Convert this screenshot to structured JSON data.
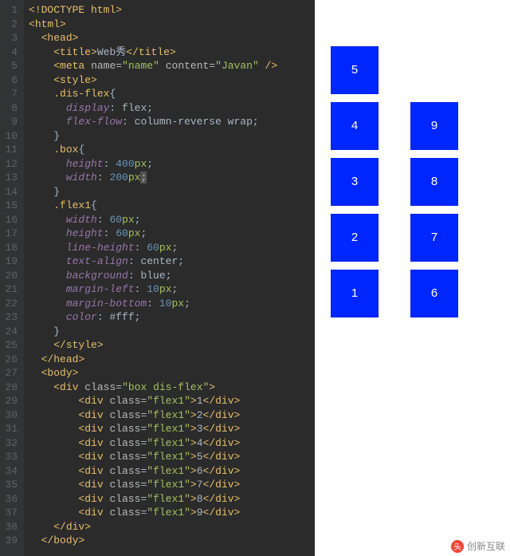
{
  "editor": {
    "line_count": 39,
    "active_line": 13,
    "lines": [
      {
        "n": 1,
        "indent": 0,
        "type": "doctype",
        "text": "<!DOCTYPE html>"
      },
      {
        "n": 2,
        "indent": 0,
        "type": "open",
        "tag": "html"
      },
      {
        "n": 3,
        "indent": 1,
        "type": "open",
        "tag": "head"
      },
      {
        "n": 4,
        "indent": 2,
        "type": "wrap",
        "tag": "title",
        "inner": "Web秀"
      },
      {
        "n": 5,
        "indent": 2,
        "type": "meta",
        "tag": "meta",
        "attrs": [
          [
            "name",
            "name"
          ],
          [
            "content",
            "Javan"
          ]
        ],
        "self_close": true
      },
      {
        "n": 6,
        "indent": 2,
        "type": "open",
        "tag": "style"
      },
      {
        "n": 7,
        "indent": 2,
        "type": "sel_open",
        "sel": ".dis-flex"
      },
      {
        "n": 8,
        "indent": 3,
        "type": "decl",
        "prop": "display",
        "val": "flex"
      },
      {
        "n": 9,
        "indent": 3,
        "type": "decl",
        "prop": "flex-flow",
        "val": "column-reverse wrap"
      },
      {
        "n": 10,
        "indent": 2,
        "type": "sel_close"
      },
      {
        "n": 11,
        "indent": 2,
        "type": "sel_open",
        "sel": ".box"
      },
      {
        "n": 12,
        "indent": 3,
        "type": "decl",
        "prop": "height",
        "num": "400",
        "unit": "px"
      },
      {
        "n": 13,
        "indent": 3,
        "type": "decl",
        "prop": "width",
        "num": "200",
        "unit": "px",
        "cursor": true
      },
      {
        "n": 14,
        "indent": 2,
        "type": "sel_close"
      },
      {
        "n": 15,
        "indent": 2,
        "type": "sel_open",
        "sel": ".flex1"
      },
      {
        "n": 16,
        "indent": 3,
        "type": "decl",
        "prop": "width",
        "num": "60",
        "unit": "px"
      },
      {
        "n": 17,
        "indent": 3,
        "type": "decl",
        "prop": "height",
        "num": "60",
        "unit": "px"
      },
      {
        "n": 18,
        "indent": 3,
        "type": "decl",
        "prop": "line-height",
        "num": "60",
        "unit": "px"
      },
      {
        "n": 19,
        "indent": 3,
        "type": "decl",
        "prop": "text-align",
        "val": "center"
      },
      {
        "n": 20,
        "indent": 3,
        "type": "decl",
        "prop": "background",
        "val": "blue"
      },
      {
        "n": 21,
        "indent": 3,
        "type": "decl",
        "prop": "margin-left",
        "num": "10",
        "unit": "px"
      },
      {
        "n": 22,
        "indent": 3,
        "type": "decl",
        "prop": "margin-bottom",
        "num": "10",
        "unit": "px"
      },
      {
        "n": 23,
        "indent": 3,
        "type": "decl",
        "prop": "color",
        "val": "#fff"
      },
      {
        "n": 24,
        "indent": 2,
        "type": "sel_close"
      },
      {
        "n": 25,
        "indent": 2,
        "type": "close",
        "tag": "style"
      },
      {
        "n": 26,
        "indent": 1,
        "type": "close",
        "tag": "head"
      },
      {
        "n": 27,
        "indent": 1,
        "type": "open",
        "tag": "body"
      },
      {
        "n": 28,
        "indent": 2,
        "type": "open_attr",
        "tag": "div",
        "attrs": [
          [
            "class",
            "box dis-flex"
          ]
        ]
      },
      {
        "n": 29,
        "indent": 4,
        "type": "wrap_attr",
        "tag": "div",
        "attrs": [
          [
            "class",
            "flex1"
          ]
        ],
        "inner": "1"
      },
      {
        "n": 30,
        "indent": 4,
        "type": "wrap_attr",
        "tag": "div",
        "attrs": [
          [
            "class",
            "flex1"
          ]
        ],
        "inner": "2"
      },
      {
        "n": 31,
        "indent": 4,
        "type": "wrap_attr",
        "tag": "div",
        "attrs": [
          [
            "class",
            "flex1"
          ]
        ],
        "inner": "3"
      },
      {
        "n": 32,
        "indent": 4,
        "type": "wrap_attr",
        "tag": "div",
        "attrs": [
          [
            "class",
            "flex1"
          ]
        ],
        "inner": "4"
      },
      {
        "n": 33,
        "indent": 4,
        "type": "wrap_attr",
        "tag": "div",
        "attrs": [
          [
            "class",
            "flex1"
          ]
        ],
        "inner": "5"
      },
      {
        "n": 34,
        "indent": 4,
        "type": "wrap_attr",
        "tag": "div",
        "attrs": [
          [
            "class",
            "flex1"
          ]
        ],
        "inner": "6"
      },
      {
        "n": 35,
        "indent": 4,
        "type": "wrap_attr",
        "tag": "div",
        "attrs": [
          [
            "class",
            "flex1"
          ]
        ],
        "inner": "7"
      },
      {
        "n": 36,
        "indent": 4,
        "type": "wrap_attr",
        "tag": "div",
        "attrs": [
          [
            "class",
            "flex1"
          ]
        ],
        "inner": "8"
      },
      {
        "n": 37,
        "indent": 4,
        "type": "wrap_attr",
        "tag": "div",
        "attrs": [
          [
            "class",
            "flex1"
          ]
        ],
        "inner": "9"
      },
      {
        "n": 38,
        "indent": 2,
        "type": "close",
        "tag": "div"
      },
      {
        "n": 39,
        "indent": 1,
        "type": "close",
        "tag": "body"
      }
    ]
  },
  "preview": {
    "items": [
      "1",
      "2",
      "3",
      "4",
      "5",
      "6",
      "7",
      "8",
      "9"
    ]
  },
  "watermark": {
    "icon": "头",
    "text": "创新互联"
  }
}
